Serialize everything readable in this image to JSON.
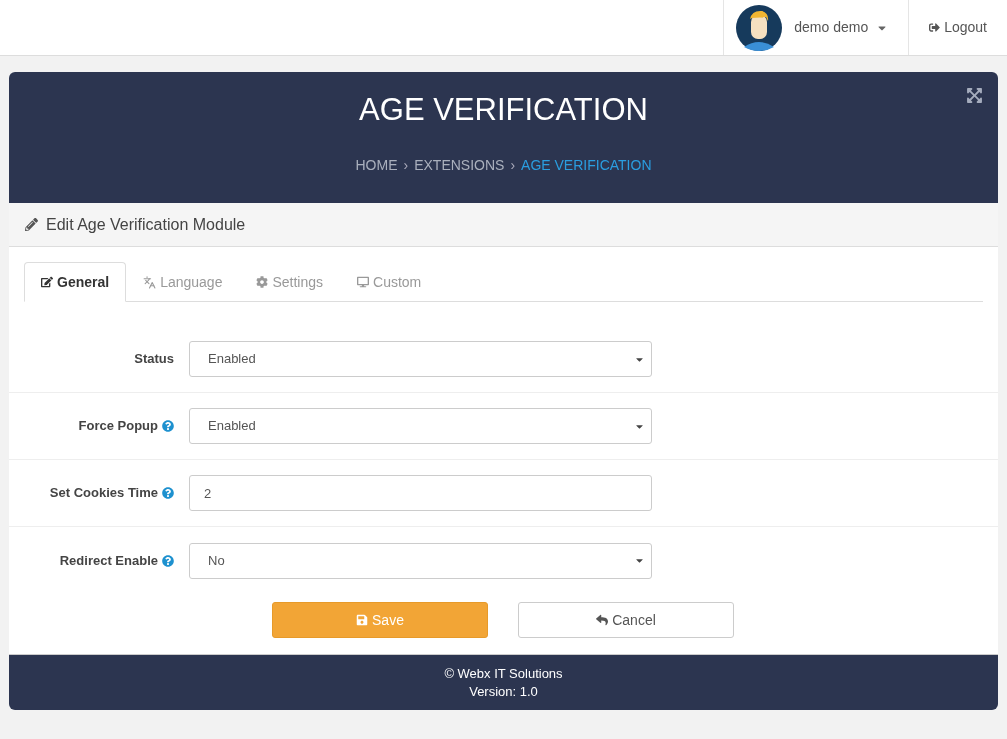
{
  "topbar": {
    "user_name": "demo demo",
    "logout": "Logout"
  },
  "header": {
    "title": "AGE VERIFICATION",
    "breadcrumb": [
      {
        "label": "HOME",
        "selected": false
      },
      {
        "separator": "›",
        "label": "EXTENSIONS",
        "selected": false
      },
      {
        "separator": "›",
        "label": "AGE VERIFICATION",
        "selected": true
      }
    ]
  },
  "panel": {
    "title": "Edit Age Verification Module"
  },
  "tabs": [
    {
      "label": "General",
      "kind": "edit",
      "selected": true
    },
    {
      "label": "Language",
      "kind": "language",
      "selected": false
    },
    {
      "label": "Settings",
      "kind": "cog",
      "selected": false
    },
    {
      "label": "Custom",
      "kind": "desktop",
      "selected": false
    }
  ],
  "fields": [
    {
      "label": "Status",
      "kind": "select",
      "value": "Enabled",
      "help": false
    },
    {
      "label": "Force Popup",
      "kind": "select",
      "value": "Enabled",
      "help": true
    },
    {
      "label": "Set Cookies Time",
      "kind": "text",
      "value": "2",
      "help": true
    },
    {
      "label": "Redirect Enable",
      "kind": "select",
      "value": "No",
      "help": true
    }
  ],
  "buttons": [
    {
      "label": "Save",
      "kind": "primary"
    },
    {
      "label": "Cancel",
      "kind": "secondary"
    }
  ],
  "footer": {
    "copyright": "© Webx IT Solutions",
    "version": "Version: 1.0"
  }
}
